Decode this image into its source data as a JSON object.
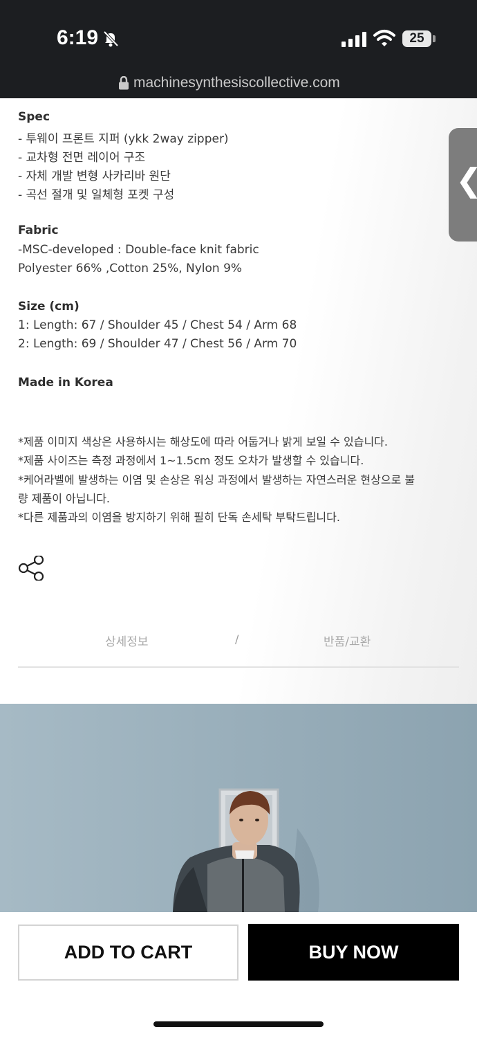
{
  "status_bar": {
    "time": "6:19",
    "battery": "25"
  },
  "browser": {
    "url": "machinesynthesiscollective.com"
  },
  "spec": {
    "title": "Spec",
    "items": [
      "- 투웨이 프론트 지퍼  (ykk 2way zipper)",
      "- 교차형 전면 레이어 구조",
      "- 자체 개발 변형 사카리바 원단",
      "- 곡선 절개 및 일체형 포켓 구성"
    ]
  },
  "fabric": {
    "title": "Fabric",
    "lines": [
      "-MSC-developed  : Double-face knit fabric",
      " Polyester 66% ,Cotton 25%, Nylon 9%"
    ]
  },
  "size": {
    "title": "Size (cm)",
    "lines": [
      "1: Length: 67 / Shoulder 45 / Chest  54 / Arm 68",
      "2: Length: 69 / Shoulder 47 / Chest  56 / Arm 70"
    ]
  },
  "origin": "Made in Korea",
  "notes": [
    "*제품 이미지 색상은 사용하시는 해상도에 따라 어둡거나 밝게 보일 수 있습니다.",
    "*제품 사이즈는 측정 과정에서 1~1.5cm 정도 오차가 발생할 수 있습니다.",
    "*케어라벨에 발생하는 이염 및 손상은 워싱 과정에서 발생하는 자연스러운 현상으로 불",
    "량 제품이 아닙니다.",
    "*다른 제품과의 이염을 방지하기 위해 필히 단독 손세탁 부탁드립니다."
  ],
  "tabs": {
    "detail": "상세정보",
    "separator": "/",
    "returns": "반품/교환"
  },
  "side_tab": {
    "glyph": "❮"
  },
  "actions": {
    "add_to_cart": "ADD TO CART",
    "buy_now": "BUY NOW"
  }
}
